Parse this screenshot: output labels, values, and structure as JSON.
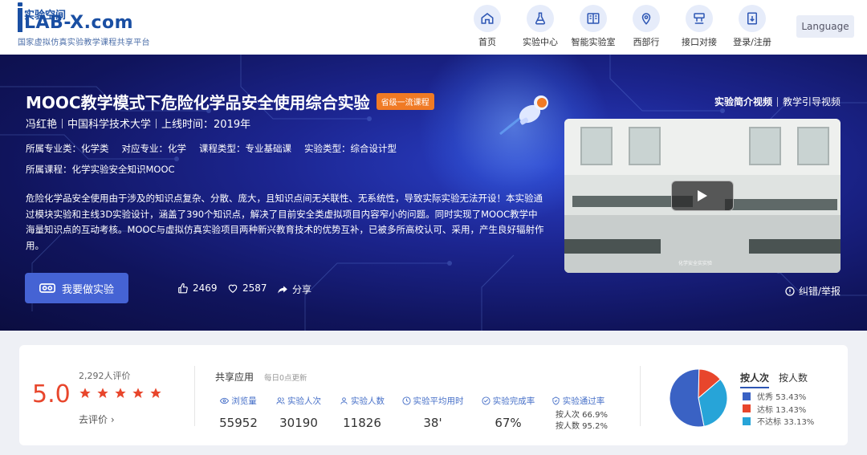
{
  "header": {
    "logo_cn": "实验空间",
    "logo_text": "LAB-X.com",
    "logo_sub": "国家虚拟仿真实验教学课程共享平台",
    "nav": [
      {
        "label": "首页",
        "icon": "home-icon"
      },
      {
        "label": "实验中心",
        "icon": "flask-icon"
      },
      {
        "label": "智能实验室",
        "icon": "book-icon"
      },
      {
        "label": "西部行",
        "icon": "location-icon"
      },
      {
        "label": "接口对接",
        "icon": "interface-icon"
      },
      {
        "label": "登录/注册",
        "icon": "login-icon"
      }
    ],
    "language": "Language"
  },
  "course": {
    "title": "MOOC教学模式下危险化学品安全使用综合实验",
    "badge": "省级一流课程",
    "author": "冯红艳",
    "school": "中国科学技术大学",
    "online_time": "上线时间：2019年",
    "attributes": [
      {
        "label": "所属专业类：",
        "value": "化学类"
      },
      {
        "label": "对应专业：",
        "value": "化学"
      },
      {
        "label": "课程类型：",
        "value": "专业基础课"
      },
      {
        "label": "实验类型：",
        "value": "综合设计型"
      }
    ],
    "course_belong_label": "所属课程：",
    "course_belong_value": "化学实验安全知识MOOC",
    "description": "危险化学品安全使用由于涉及的知识点复杂、分散、庞大，且知识点间无关联性、无系统性，导致实际实验无法开设！本实验通过模块实验和主线3D实验设计，涵盖了390个知识点，解决了目前安全类虚拟项目内容窄小的问题。同时实现了MOOC教学中海量知识点的互动考核。MOOC与虚拟仿真实验项目两种新兴教育技术的优势互补，已被多所高校认可、采用，产生良好辐射作用。",
    "experiment_button": "我要做实验",
    "likes": "2469",
    "favorites": "2587",
    "share": "分享",
    "video_tabs": [
      "实验简介视频",
      "教学引导视频"
    ],
    "video_caption": "化学安全实实验",
    "report": "纠错/举报"
  },
  "stats": {
    "score": "5.0",
    "review_count": "2,292人评价",
    "stars": 5,
    "go_review": "去评价",
    "share_title": "共享应用",
    "share_sub": "每日0点更新",
    "metrics": [
      {
        "label": "浏览量",
        "value": "55952",
        "icon": "eye-icon"
      },
      {
        "label": "实验人次",
        "value": "30190",
        "icon": "users-icon"
      },
      {
        "label": "实验人数",
        "value": "11826",
        "icon": "user-icon"
      },
      {
        "label": "实验平均用时",
        "value": "38'",
        "icon": "clock-icon"
      },
      {
        "label": "实验完成率",
        "value": "67%",
        "icon": "check-circle-icon"
      },
      {
        "label": "实验通过率",
        "value": "",
        "icon": "shield-icon"
      }
    ],
    "pass_by_times": "按人次 66.9%",
    "pass_by_people": "按人数 95.2%",
    "pie_tabs": [
      "按人次",
      "按人数"
    ],
    "legend": [
      {
        "label": "优秀 53.43%",
        "value": 53.43,
        "color": "#3a62c4"
      },
      {
        "label": "达标 13.43%",
        "value": 13.43,
        "color": "#e8462c"
      },
      {
        "label": "不达标 33.13%",
        "value": 33.13,
        "color": "#27a4d8"
      }
    ]
  },
  "colors": {
    "brand": "#1a4fa3",
    "accent": "#4563d4",
    "score": "#e8462c",
    "badge": "#f07a24"
  }
}
